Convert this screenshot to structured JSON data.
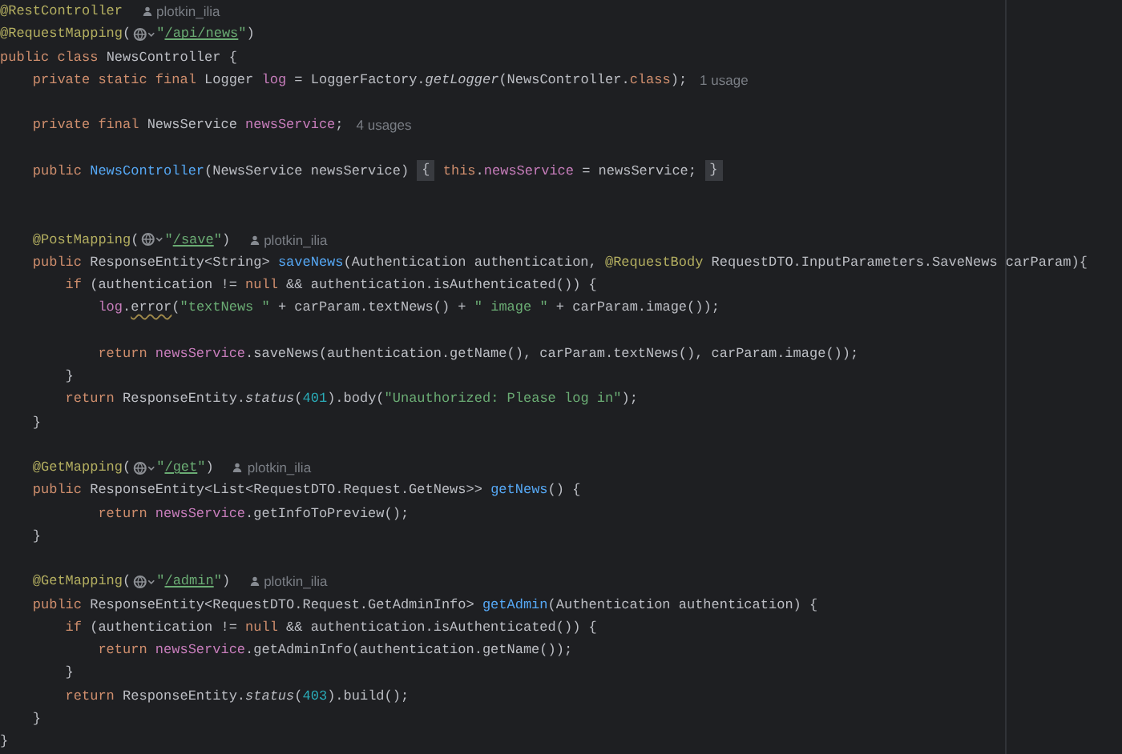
{
  "editor": {
    "lines": [
      {
        "kind": "code",
        "segments": [
          {
            "kind": "annotation",
            "text": "@RestController"
          },
          {
            "kind": "author",
            "text": "plotkin_ilia"
          }
        ]
      },
      {
        "kind": "code",
        "segments": [
          {
            "kind": "annotation",
            "text": "@RequestMapping"
          },
          {
            "kind": "plain",
            "text": "("
          },
          {
            "kind": "globe"
          },
          {
            "kind": "string",
            "text": "\""
          },
          {
            "kind": "link",
            "text": "/api/news"
          },
          {
            "kind": "string",
            "text": "\""
          },
          {
            "kind": "plain",
            "text": ")"
          }
        ]
      },
      {
        "kind": "code",
        "segments": [
          {
            "kind": "keyword",
            "text": "public class "
          },
          {
            "kind": "plain",
            "text": "NewsController {"
          }
        ]
      },
      {
        "kind": "code",
        "segments": [
          {
            "kind": "keyword",
            "text": "    private static final "
          },
          {
            "kind": "plain",
            "text": "Logger "
          },
          {
            "kind": "field",
            "text": "log"
          },
          {
            "kind": "plain",
            "text": " = LoggerFactory."
          },
          {
            "kind": "static",
            "text": "getLogger"
          },
          {
            "kind": "plain",
            "text": "(NewsController."
          },
          {
            "kind": "keyword",
            "text": "class"
          },
          {
            "kind": "plain",
            "text": ");"
          },
          {
            "kind": "hint",
            "text": "1 usage"
          }
        ]
      },
      {
        "kind": "blank"
      },
      {
        "kind": "code",
        "segments": [
          {
            "kind": "keyword",
            "text": "    private final "
          },
          {
            "kind": "plain",
            "text": "NewsService "
          },
          {
            "kind": "field",
            "text": "newsService"
          },
          {
            "kind": "plain",
            "text": ";"
          },
          {
            "kind": "hint",
            "text": "4 usages"
          }
        ]
      },
      {
        "kind": "blank"
      },
      {
        "kind": "code",
        "segments": [
          {
            "kind": "keyword",
            "text": "    public "
          },
          {
            "kind": "method",
            "text": "NewsController"
          },
          {
            "kind": "plain",
            "text": "(NewsService newsService) "
          },
          {
            "kind": "fold",
            "text": "{"
          },
          {
            "kind": "keyword",
            "text": " this"
          },
          {
            "kind": "plain",
            "text": "."
          },
          {
            "kind": "field",
            "text": "newsService"
          },
          {
            "kind": "plain",
            "text": " = newsService; "
          },
          {
            "kind": "fold",
            "text": "}"
          }
        ]
      },
      {
        "kind": "blank"
      },
      {
        "kind": "blank"
      },
      {
        "kind": "code",
        "segments": [
          {
            "kind": "annotation",
            "text": "    @PostMapping"
          },
          {
            "kind": "plain",
            "text": "("
          },
          {
            "kind": "globe"
          },
          {
            "kind": "string",
            "text": "\""
          },
          {
            "kind": "link",
            "text": "/save"
          },
          {
            "kind": "string",
            "text": "\""
          },
          {
            "kind": "plain",
            "text": ")"
          },
          {
            "kind": "author",
            "text": "plotkin_ilia"
          }
        ]
      },
      {
        "kind": "code",
        "segments": [
          {
            "kind": "keyword",
            "text": "    public "
          },
          {
            "kind": "plain",
            "text": "ResponseEntity<String> "
          },
          {
            "kind": "method",
            "text": "saveNews"
          },
          {
            "kind": "plain",
            "text": "(Authentication authentication, "
          },
          {
            "kind": "annotation",
            "text": "@RequestBody"
          },
          {
            "kind": "plain",
            "text": " RequestDTO.InputParameters.SaveNews carParam){"
          }
        ]
      },
      {
        "kind": "code",
        "segments": [
          {
            "kind": "keyword",
            "text": "        if "
          },
          {
            "kind": "plain",
            "text": "(authentication != "
          },
          {
            "kind": "keyword",
            "text": "null"
          },
          {
            "kind": "plain",
            "text": " && authentication.isAuthenticated()) {"
          }
        ]
      },
      {
        "kind": "code",
        "segments": [
          {
            "kind": "field",
            "text": "            log"
          },
          {
            "kind": "plain",
            "text": "."
          },
          {
            "kind": "warn",
            "text": "error"
          },
          {
            "kind": "plain",
            "text": "("
          },
          {
            "kind": "string",
            "text": "\"textNews \""
          },
          {
            "kind": "plain",
            "text": " + carParam.textNews() + "
          },
          {
            "kind": "string",
            "text": "\" image \""
          },
          {
            "kind": "plain",
            "text": " + carParam.image());"
          }
        ]
      },
      {
        "kind": "blank"
      },
      {
        "kind": "code",
        "segments": [
          {
            "kind": "keyword",
            "text": "            return "
          },
          {
            "kind": "field",
            "text": "newsService"
          },
          {
            "kind": "plain",
            "text": ".saveNews(authentication.getName(), carParam.textNews(), carParam.image());"
          }
        ]
      },
      {
        "kind": "code",
        "segments": [
          {
            "kind": "plain",
            "text": "        }"
          }
        ]
      },
      {
        "kind": "code",
        "segments": [
          {
            "kind": "keyword",
            "text": "        return "
          },
          {
            "kind": "plain",
            "text": "ResponseEntity."
          },
          {
            "kind": "static",
            "text": "status"
          },
          {
            "kind": "plain",
            "text": "("
          },
          {
            "kind": "number",
            "text": "401"
          },
          {
            "kind": "plain",
            "text": ").body("
          },
          {
            "kind": "string",
            "text": "\"Unauthorized: Please log in\""
          },
          {
            "kind": "plain",
            "text": ");"
          }
        ]
      },
      {
        "kind": "code",
        "segments": [
          {
            "kind": "plain",
            "text": "    }"
          }
        ]
      },
      {
        "kind": "blank"
      },
      {
        "kind": "code",
        "segments": [
          {
            "kind": "annotation",
            "text": "    @GetMapping"
          },
          {
            "kind": "plain",
            "text": "("
          },
          {
            "kind": "globe"
          },
          {
            "kind": "string",
            "text": "\""
          },
          {
            "kind": "link",
            "text": "/get"
          },
          {
            "kind": "string",
            "text": "\""
          },
          {
            "kind": "plain",
            "text": ")"
          },
          {
            "kind": "author",
            "text": "plotkin_ilia"
          }
        ]
      },
      {
        "kind": "code",
        "segments": [
          {
            "kind": "keyword",
            "text": "    public "
          },
          {
            "kind": "plain",
            "text": "ResponseEntity<List<RequestDTO.Request.GetNews>> "
          },
          {
            "kind": "method",
            "text": "getNews"
          },
          {
            "kind": "plain",
            "text": "() {"
          }
        ]
      },
      {
        "kind": "code",
        "segments": [
          {
            "kind": "keyword",
            "text": "            return "
          },
          {
            "kind": "field",
            "text": "newsService"
          },
          {
            "kind": "plain",
            "text": ".getInfoToPreview();"
          }
        ]
      },
      {
        "kind": "code",
        "segments": [
          {
            "kind": "plain",
            "text": "    }"
          }
        ]
      },
      {
        "kind": "blank"
      },
      {
        "kind": "code",
        "segments": [
          {
            "kind": "annotation",
            "text": "    @GetMapping"
          },
          {
            "kind": "plain",
            "text": "("
          },
          {
            "kind": "globe"
          },
          {
            "kind": "string",
            "text": "\""
          },
          {
            "kind": "link",
            "text": "/admin"
          },
          {
            "kind": "string",
            "text": "\""
          },
          {
            "kind": "plain",
            "text": ")"
          },
          {
            "kind": "author",
            "text": "plotkin_ilia"
          }
        ]
      },
      {
        "kind": "code",
        "segments": [
          {
            "kind": "keyword",
            "text": "    public "
          },
          {
            "kind": "plain",
            "text": "ResponseEntity<RequestDTO.Request.GetAdminInfo> "
          },
          {
            "kind": "method",
            "text": "getAdmin"
          },
          {
            "kind": "plain",
            "text": "(Authentication authentication) {"
          }
        ]
      },
      {
        "kind": "code",
        "segments": [
          {
            "kind": "keyword",
            "text": "        if "
          },
          {
            "kind": "plain",
            "text": "(authentication != "
          },
          {
            "kind": "keyword",
            "text": "null"
          },
          {
            "kind": "plain",
            "text": " && authentication.isAuthenticated()) {"
          }
        ]
      },
      {
        "kind": "code",
        "segments": [
          {
            "kind": "keyword",
            "text": "            return "
          },
          {
            "kind": "field",
            "text": "newsService"
          },
          {
            "kind": "plain",
            "text": ".getAdminInfo(authentication.getName());"
          }
        ]
      },
      {
        "kind": "code",
        "segments": [
          {
            "kind": "plain",
            "text": "        }"
          }
        ]
      },
      {
        "kind": "code",
        "segments": [
          {
            "kind": "keyword",
            "text": "        return "
          },
          {
            "kind": "plain",
            "text": "ResponseEntity."
          },
          {
            "kind": "static",
            "text": "status"
          },
          {
            "kind": "plain",
            "text": "("
          },
          {
            "kind": "number",
            "text": "403"
          },
          {
            "kind": "plain",
            "text": ").build();"
          }
        ]
      },
      {
        "kind": "code",
        "segments": [
          {
            "kind": "plain",
            "text": "    }"
          }
        ]
      },
      {
        "kind": "code",
        "segments": [
          {
            "kind": "plain",
            "text": "}"
          }
        ]
      }
    ]
  }
}
